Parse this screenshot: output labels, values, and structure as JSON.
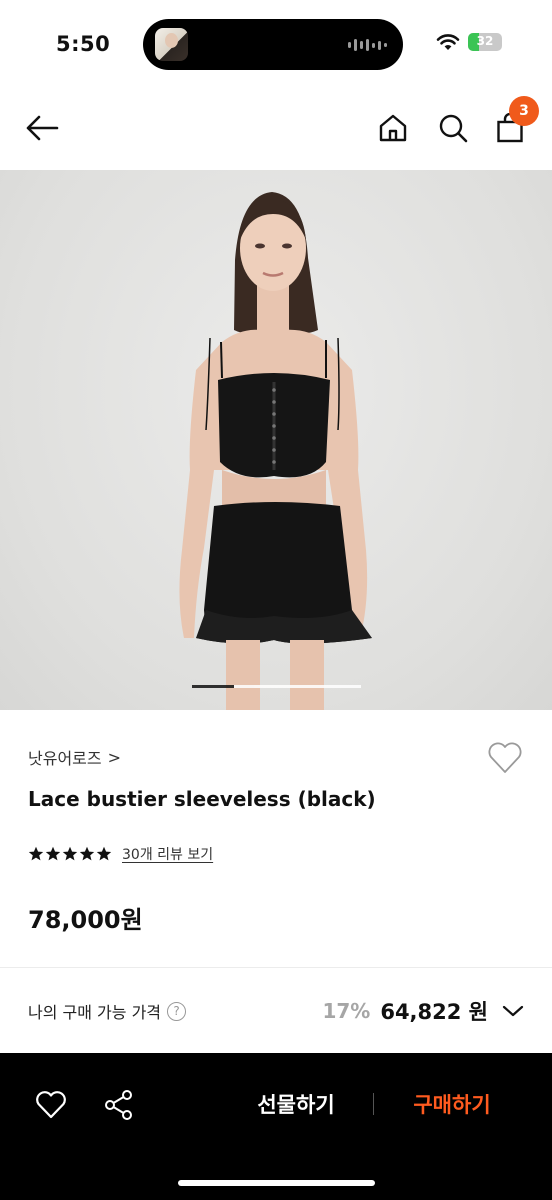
{
  "status_bar": {
    "time": "5:50",
    "battery": "32",
    "battery_level": 0.32
  },
  "header": {
    "back_icon": "arrow-left-icon",
    "home_icon": "home-icon",
    "search_icon": "search-icon",
    "bag_icon": "shopping-bag-icon",
    "cart_count": "3"
  },
  "gallery": {
    "current_index": 1,
    "progress_fraction": 0.25
  },
  "product": {
    "brand": "낫유어로즈",
    "brand_chevron": ">",
    "name": "Lace bustier sleeveless (black)",
    "rating_stars": 5,
    "review_link": "30개 리뷰 보기",
    "price": "78,000원"
  },
  "my_price": {
    "label": "나의 구매 가능 가격",
    "help": "?",
    "discount": "17%",
    "price": "64,822 원"
  },
  "bottom_bar": {
    "wish_icon": "heart-icon",
    "share_icon": "share-icon",
    "gift_label": "선물하기",
    "buy_label": "구매하기"
  },
  "colors": {
    "accent": "#ff5b1f",
    "badge": "#f05a1b",
    "bar_bg": "#000000"
  }
}
